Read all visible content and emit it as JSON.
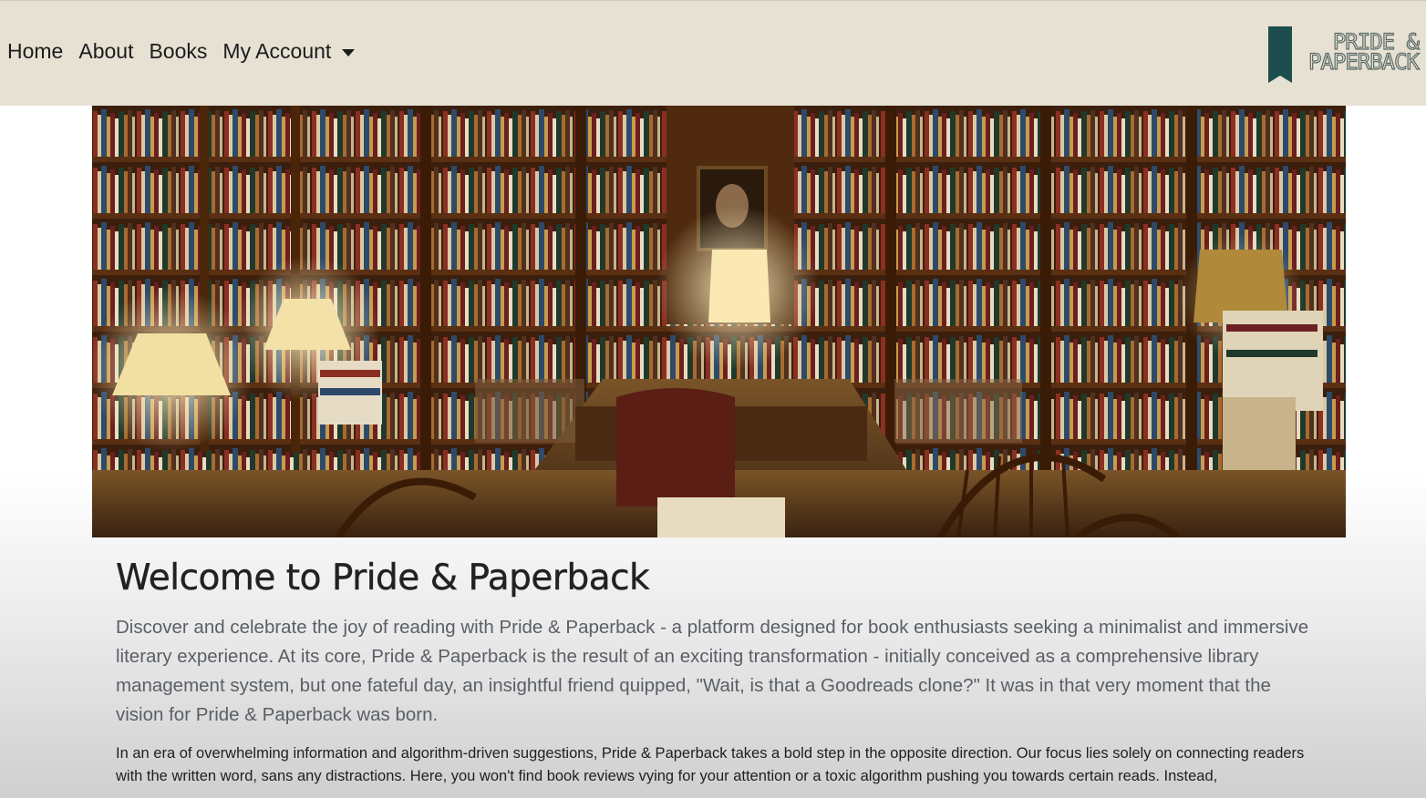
{
  "nav": {
    "home": "Home",
    "about": "About",
    "books": "Books",
    "account": "My Account"
  },
  "brand": {
    "line1": "PRIDE &",
    "line2": "PAPERBACK",
    "icon": "bookmark-icon",
    "icon_color": "#1e4d4f"
  },
  "hero": {
    "image": "bookstore interior"
  },
  "main": {
    "title": "Welcome to Pride & Paperback",
    "lead": "Discover and celebrate the joy of reading with Pride & Paperback - a platform designed for book enthusiasts seeking a minimalist and immersive literary experience. At its core, Pride & Paperback is the result of an exciting transformation - initially conceived as a comprehensive library management system, but one fateful day, an insightful friend quipped, \"Wait, is that a Goodreads clone?\" It was in that very moment that the vision for Pride & Paperback was born.",
    "paragraph": "In an era of overwhelming information and algorithm-driven suggestions, Pride & Paperback takes a bold step in the opposite direction. Our focus lies solely on connecting readers with the written word, sans any distractions. Here, you won't find book reviews vying for your attention or a toxic algorithm pushing you towards certain reads. Instead,"
  },
  "colors": {
    "navbar_bg": "#e6e1d3",
    "brand_teal": "#1e4d4f"
  }
}
